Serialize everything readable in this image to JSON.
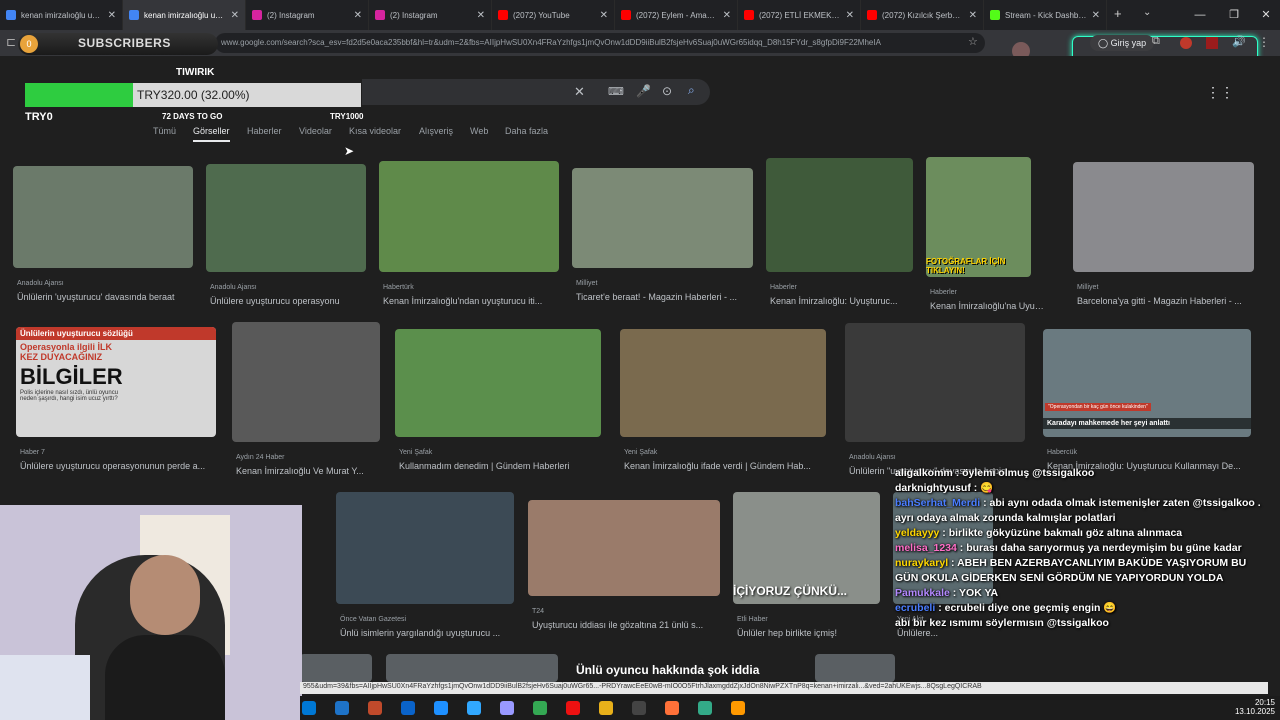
{
  "tabs": [
    {
      "title": "kenan imirzalıoğlu uyuş",
      "color": "#4285f4"
    },
    {
      "title": "kenan imirzalıoğlu uyuş",
      "color": "#4285f4"
    },
    {
      "title": "(2) Instagram",
      "color": "#d6249f"
    },
    {
      "title": "(2) Instagram",
      "color": "#d6249f"
    },
    {
      "title": "(2072) YouTube",
      "color": "#ff0000"
    },
    {
      "title": "(2072) Eylem - Aman (C",
      "color": "#ff0000"
    },
    {
      "title": "(2072) ETLİ EKMEK MUK",
      "color": "#ff0000"
    },
    {
      "title": "(2072) Kızılcık Şerbeti 1(",
      "color": "#ff0000"
    },
    {
      "title": "Stream - Kick Dashboar",
      "color": "#53fc18"
    }
  ],
  "address": {
    "url": "www.google.com/search?sca_esv=fd2d5e0aca235bbf&hl=tr&udm=2&fbs=AIIjpHwSU0Xn4FRaYzhfgs1jmQvOnw1dDD9iiBulB2fsjeHv6Suaj0uWGr65idqq_D8h15FYdr_s8gfpDi9F22MheIA"
  },
  "browser": {
    "signin_label": "Giriş yap"
  },
  "overlay": {
    "subscribers_count": "0",
    "subscribers_label": "SUBSCRIBERS",
    "goal_name": "TIWIRIK",
    "goal_amount": "TRY320.00 (32.00%)",
    "goal_progress": 0.32,
    "goal_start": "TRY0",
    "goal_days": "72 DAYS TO GO",
    "goal_target": "TRY1000"
  },
  "google": {
    "nav_tabs": [
      "Tümü",
      "Görseller",
      "Haberler",
      "Videolar",
      "Kısa videolar",
      "Alışveriş",
      "Web",
      "Daha fazla"
    ],
    "active_tab": "Görseller"
  },
  "results_row1": [
    {
      "source": "Anadolu Ajansı",
      "title": "Ünlülerin 'uyuşturucu' davasında beraat",
      "color": "#6b7a6a"
    },
    {
      "source": "Anadolu Ajansı",
      "title": "Ünlülere uyuşturucu operasyonu",
      "color": "#4f6b4e"
    },
    {
      "source": "Habertürk",
      "title": "Kenan İmirzalıoğlu'ndan uyuşturucu iti...",
      "color": "#5f8a4a"
    },
    {
      "source": "Milliyet",
      "title": "Ticaret'e beraat! - Magazin Haberleri - ...",
      "color": "#7c8a76"
    },
    {
      "source": "Haberler",
      "title": "Kenan İmirzalıoğlu: Uyuşturuc...",
      "color": "#3f5a3a"
    },
    {
      "source": "Haberler",
      "title": "Kenan İmirzalıoğlu'na Uyuş...",
      "color": "#6c8d5d"
    },
    {
      "source": "Milliyet",
      "title": "Barcelona'ya gitti - Magazin Haberleri - ...",
      "color": "#8a8a8e"
    }
  ],
  "results_row1_overlay": "FOTOĞRAFLAR İÇİN TIKLAYIN!",
  "results_row2": [
    {
      "source": "Haber 7",
      "title": "Ünlülere uyuşturucu operasyonunun perde a...",
      "color": "#d7d7d7"
    },
    {
      "source": "Aydın 24 Haber",
      "title": "Kenan İmirzalıoğlu Ve Murat Y...",
      "color": "#595959"
    },
    {
      "source": "Yeni Şafak",
      "title": "Kullanmadım denedim | Gündem Haberleri",
      "color": "#5b8f4c"
    },
    {
      "source": "Yeni Şafak",
      "title": "Kenan İmirzalıoğlu ifade verdi | Gündem Hab...",
      "color": "#7a6a4e"
    },
    {
      "source": "Anadolu Ajansı",
      "title": "Ünlülerin \"uyuşturucu\" davasında hapis...",
      "color": "#3a3a3a"
    },
    {
      "source": "Habercük",
      "title": "Kenan İmirzalıoğlu: Uyuşturucu Kullanmayı De...",
      "color": "#6a7a80"
    }
  ],
  "results_row2_text": {
    "headline_top": "Ünlülerin uyuşturucu sözlüğü",
    "headline_mid": "Operasyonla ilgili İLK KEZ DUYACAĞINIZ",
    "headline_big": "BİLGİLER",
    "headline_small": "Polis içlerine nasıl sızdı, ünlü oyuncu neden şaşırdı, hangi isim ucuz yırttı?",
    "karadayi": "Karadayı mahkemede her şeyi anlattı",
    "karadayi_tag": "\"Operasyondan bir kaç gün önce kulakinden\""
  },
  "results_row3": [
    {
      "source": "Önce Vatan Gazetesi",
      "title": "Ünlü isimlerin yargılandığı uyuşturucu ...",
      "color": "#3c4a55"
    },
    {
      "source": "T24",
      "title": "Uyuşturucu iddiası ile gözaltına 21 ünlü s...",
      "color": "#9a7b6a"
    },
    {
      "source": "Etli Haber",
      "title": "Ünlüler hep birlikte içmiş!",
      "color": "#8a8f8a"
    },
    {
      "source": "Yeni Akit",
      "title": "Ünlülere...",
      "color": "#5a6a6f"
    }
  ],
  "results_row3_caption": "İÇİYORUZ ÇÜNKÜ...",
  "bottom_banner": "Ünlü oyuncu hakkında şok iddia",
  "chat": [
    {
      "user": "aligalkomm",
      "msg": "öylemi olmuş @tssigalkoo",
      "ucolor": "#ffffff"
    },
    {
      "user": "darknightyusuf",
      "msg": "😋",
      "ucolor": "#ffffff"
    },
    {
      "user": "bahSerhat_Merdi",
      "msg": "abi aynı odada olmak istemenişler zaten @tssigalkoo . ayrı odaya almak zorunda kalmışlar polatlari",
      "ucolor": "#4a7dff"
    },
    {
      "user": "yeldayyy",
      "msg": "birlikte gökyüzüne bakmalı göz altına alınmaca",
      "ucolor": "#ffd700"
    },
    {
      "user": "melisa_1234",
      "msg": "burası daha sarıyormuş ya nerdeymişim bu güne kadar",
      "ucolor": "#ff6ec7"
    },
    {
      "user": "nuraykaryl",
      "msg": "ABEH BEN AZERBAYCANLIYIM BAKÜDE YAŞIYORUM BU GÜN OKULA GİDERKEN SENİ GÖRDÜM NE YAPIYORDUN YOLDA",
      "ucolor": "#ffd700"
    },
    {
      "user": "Pamukkale",
      "msg": "YOK YA",
      "ucolor": "#b388ff"
    },
    {
      "user": "ecrubeli",
      "msg": "ecrubeli diye one geçmiş engin 😄",
      "ucolor": "#4a7dff"
    },
    {
      "user": "",
      "msg": "abı bır kez ısmımı söylermısın @tssigalkoo",
      "ucolor": "#ffffff"
    }
  ],
  "status_url": "955&udm=39&fbs=AIIjpHwSU0Xn4FRaYzhfgs1jmQvOnw1dDD9iiBulB2fsjeHv6Suaj0uWGr65...-PRDYrawcEeE0wB-mIO0O5FtrhJlaxmgddZjxJdOn8NiwPZXTnP8q=kenan+imirzali...&ved=2ahUKEwjs...8QsgLegQICRAB",
  "clock": {
    "time": "20:15",
    "date": "13.10.2025"
  }
}
